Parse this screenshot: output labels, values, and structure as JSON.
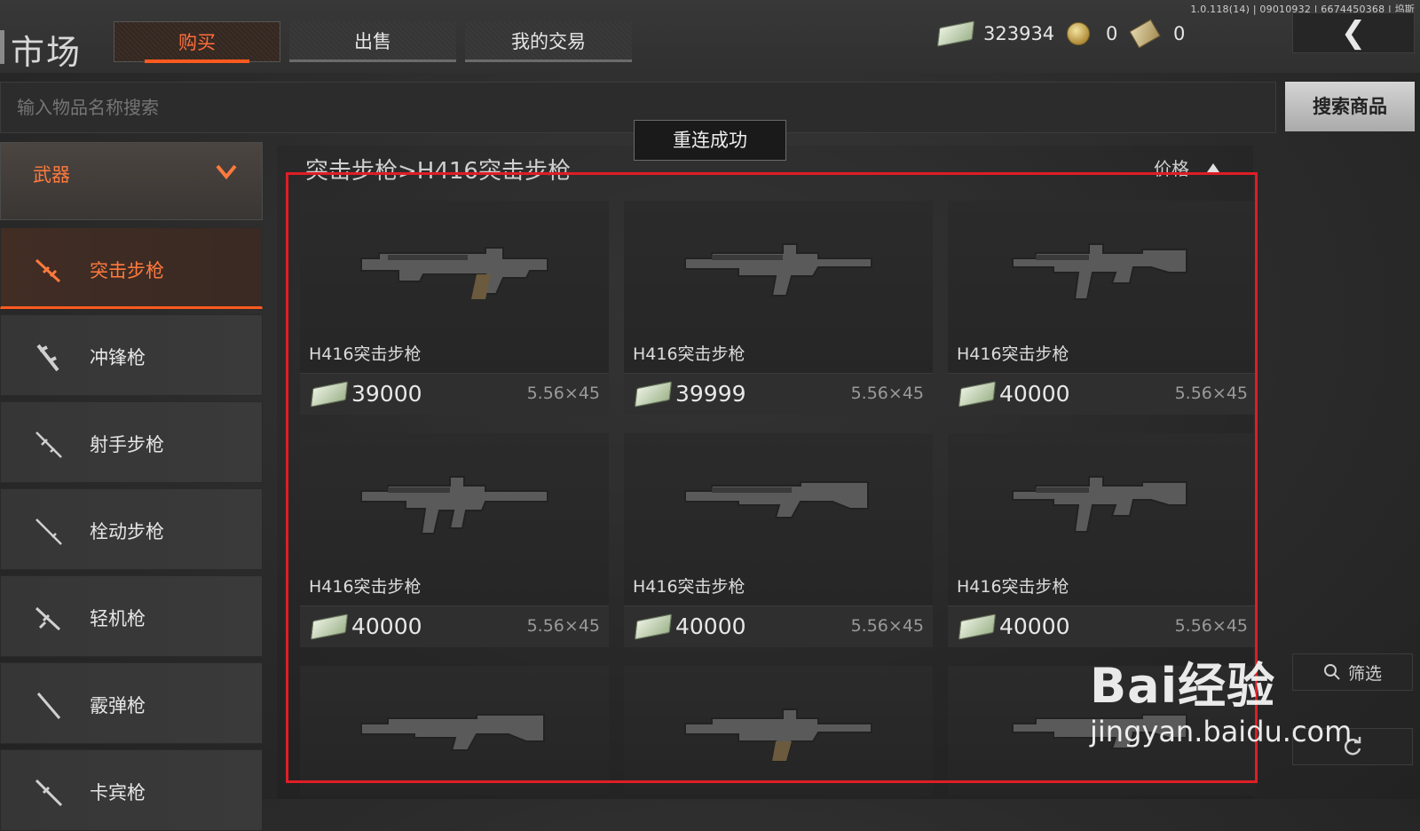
{
  "version": "1.0.118(14) | 09010932 | 6674450368 | 坞斯",
  "header": {
    "title": "市场",
    "tabs": [
      {
        "label": "购买",
        "active": true
      },
      {
        "label": "出售",
        "active": false
      },
      {
        "label": "我的交易",
        "active": false
      }
    ],
    "currency": {
      "cash": "323934",
      "coins": "0",
      "tickets": "0"
    }
  },
  "search": {
    "placeholder": "输入物品名称搜索",
    "button_label": "搜索商品"
  },
  "toast": "重连成功",
  "sidebar": {
    "category": "武器",
    "items": [
      {
        "label": "突击步枪",
        "icon": "assault-rifle-icon",
        "active": true
      },
      {
        "label": "冲锋枪",
        "icon": "smg-icon",
        "active": false
      },
      {
        "label": "射手步枪",
        "icon": "marksman-rifle-icon",
        "active": false
      },
      {
        "label": "栓动步枪",
        "icon": "bolt-action-rifle-icon",
        "active": false
      },
      {
        "label": "轻机枪",
        "icon": "lmg-icon",
        "active": false
      },
      {
        "label": "霰弹枪",
        "icon": "shotgun-icon",
        "active": false
      },
      {
        "label": "卡宾枪",
        "icon": "carbine-icon",
        "active": false
      }
    ]
  },
  "listing": {
    "breadcrumb": "突击步枪>H416突击步枪",
    "sort_label": "价格",
    "items": [
      {
        "name": "H416突击步枪",
        "price": "39000",
        "caliber": "5.56×45"
      },
      {
        "name": "H416突击步枪",
        "price": "39999",
        "caliber": "5.56×45"
      },
      {
        "name": "H416突击步枪",
        "price": "40000",
        "caliber": "5.56×45"
      },
      {
        "name": "H416突击步枪",
        "price": "40000",
        "caliber": "5.56×45"
      },
      {
        "name": "H416突击步枪",
        "price": "40000",
        "caliber": "5.56×45"
      },
      {
        "name": "H416突击步枪",
        "price": "40000",
        "caliber": "5.56×45"
      }
    ]
  },
  "filter_label": "筛选",
  "watermark": {
    "brand": "Bai经验",
    "url": "jingyan.baidu.com"
  },
  "colors": {
    "accent": "#ff5a1f",
    "highlight_frame": "#e01d25"
  }
}
